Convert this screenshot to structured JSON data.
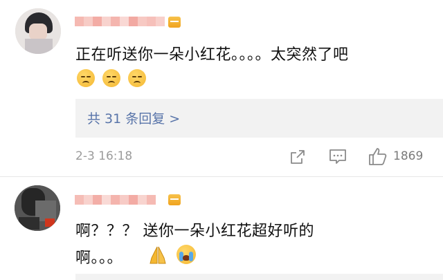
{
  "comments": [
    {
      "text": "正在听送你一朵小红花。。。。太突然了吧",
      "emojis": [
        "disappointed-face",
        "disappointed-face",
        "disappointed-face"
      ],
      "replies_label": "共 31 条回复 >",
      "timestamp": "2-3 16:18",
      "likes": "1869"
    },
    {
      "text_line1": "啊？？？ 送你一朵小红花超好听的",
      "text_line2": "啊。。。",
      "emojis": [
        "folded-hands",
        "loudly-crying-face"
      ]
    }
  ],
  "colors": {
    "link": "#5874a9",
    "meta": "#9b9b9b",
    "reply_bg": "#f2f2f2",
    "badge": "#f0a31f"
  }
}
